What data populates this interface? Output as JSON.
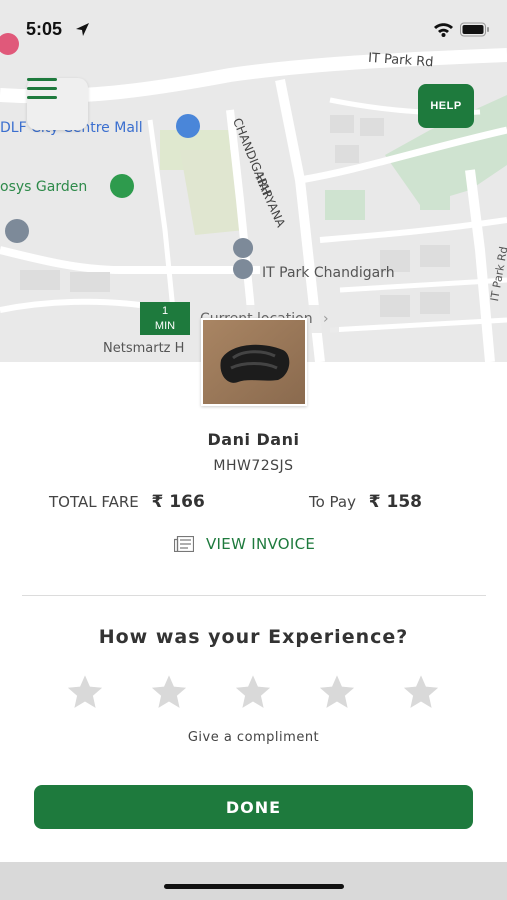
{
  "status_bar": {
    "time": "5:05"
  },
  "map": {
    "labels": {
      "it_park_rd": "IT Park Rd",
      "dlf_mall": "DLF City Centre Mall",
      "infosys_garden": "osys Garden",
      "haryana": "HARYANA",
      "chandigarh": "CHANDIGARH",
      "it_park_chandigarh": "IT Park Chandigarh",
      "netsmartz": "Netsmartz H",
      "it_park_rd_vertical": "IT Park Rd"
    },
    "help_label": "HELP",
    "eta": {
      "value": "1",
      "unit": "MIN"
    },
    "location_label": "Current location"
  },
  "driver": {
    "name": "Dani Dani",
    "vehicle_number": "MHW72SJS"
  },
  "fare": {
    "total_label": "TOTAL FARE",
    "total_amount": "₹ 166",
    "to_pay_label": "To Pay",
    "to_pay_amount": "₹ 158"
  },
  "invoice": {
    "label": "VIEW INVOICE"
  },
  "rating": {
    "title": "How was your Experience?",
    "max_stars": 5,
    "selected": 0,
    "compliment_label": "Give a compliment"
  },
  "done_label": "DONE",
  "colors": {
    "accent": "#1e7a3d",
    "map_bg": "#e9e9e9",
    "star": "#d9d9d9"
  }
}
